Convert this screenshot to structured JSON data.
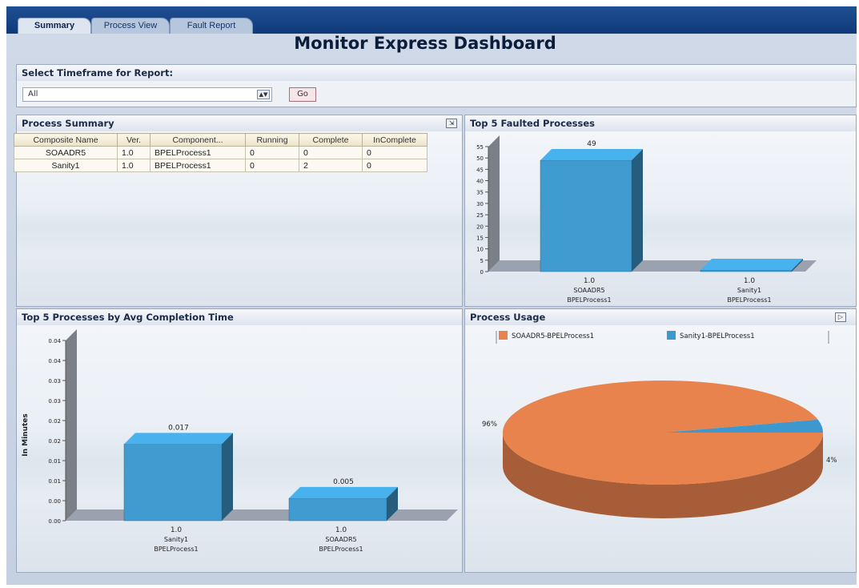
{
  "tabs": [
    {
      "label": "Summary",
      "active": true
    },
    {
      "label": "Process View",
      "active": false
    },
    {
      "label": "Fault Report",
      "active": false
    }
  ],
  "title": "Monitor Express Dashboard",
  "timeframe": {
    "label": "Select Timeframe for Report:",
    "selected": "All",
    "go_label": "Go"
  },
  "process_summary": {
    "title": "Process Summary",
    "columns": [
      "Composite Name",
      "Ver.",
      "Component...",
      "Running",
      "Complete",
      "InComplete"
    ],
    "rows": [
      [
        "SOAADR5",
        "1.0",
        "BPELProcess1",
        "0",
        "0",
        "0"
      ],
      [
        "Sanity1",
        "1.0",
        "BPELProcess1",
        "0",
        "2",
        "0"
      ]
    ]
  },
  "top_faulted": {
    "title": "Top 5 Faulted Processes"
  },
  "avg_completion": {
    "title": "Top 5 Processes by Avg Completion Time"
  },
  "process_usage": {
    "title": "Process Usage"
  },
  "chart_data": [
    {
      "type": "bar",
      "title": "Top 5 Faulted Processes",
      "categories": [
        {
          "version": "1.0",
          "composite": "SOAADR5",
          "component": "BPELProcess1"
        },
        {
          "version": "1.0",
          "composite": "Sanity1",
          "component": "BPELProcess1"
        }
      ],
      "values": [
        49,
        0
      ],
      "value_labels": [
        "49",
        ""
      ],
      "yticks": [
        "0",
        "5",
        "10",
        "15",
        "20",
        "25",
        "30",
        "35",
        "40",
        "45",
        "50",
        "55"
      ],
      "ylim": [
        0,
        55
      ],
      "color": "#3f9bd0"
    },
    {
      "type": "bar",
      "title": "Top 5 Processes by Avg Completion Time",
      "ylabel": "In Minutes",
      "categories": [
        {
          "version": "1.0",
          "composite": "Sanity1",
          "component": "BPELProcess1"
        },
        {
          "version": "1.0",
          "composite": "SOAADR5",
          "component": "BPELProcess1"
        }
      ],
      "values": [
        0.017,
        0.005
      ],
      "value_labels": [
        "0.017",
        "0.005"
      ],
      "yticks": [
        "0.00",
        "0.00",
        "0.01",
        "0.01",
        "0.02",
        "0.02",
        "0.03",
        "0.03",
        "0.04",
        "0.04"
      ],
      "ylim": [
        0,
        0.04
      ],
      "color": "#3f9bd0"
    },
    {
      "type": "pie",
      "title": "Process Usage",
      "slices": [
        {
          "label": "SOAADR5-BPELProcess1",
          "value": 96,
          "display": "96%",
          "color": "#e8834e"
        },
        {
          "label": "Sanity1-BPELProcess1",
          "value": 4,
          "display": "4%",
          "color": "#3d98cf"
        }
      ]
    }
  ]
}
